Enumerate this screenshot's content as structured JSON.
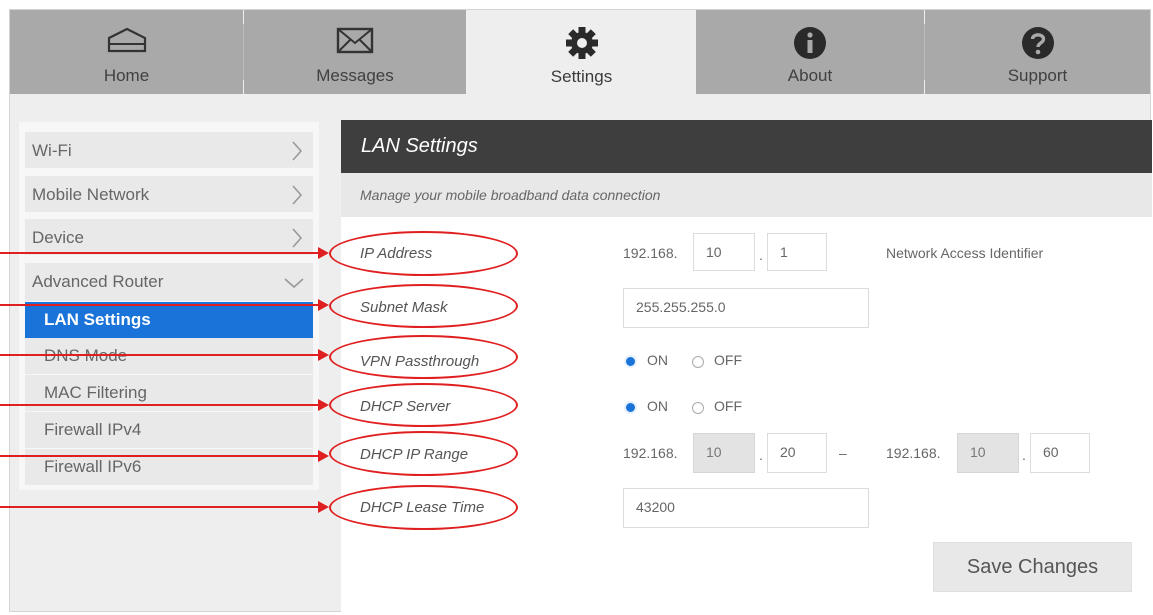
{
  "nav": {
    "tabs": [
      {
        "label": "Home",
        "icon": "home-icon"
      },
      {
        "label": "Messages",
        "icon": "envelope-icon"
      },
      {
        "label": "Settings",
        "icon": "gear-icon",
        "active": true
      },
      {
        "label": "About",
        "icon": "info-icon"
      },
      {
        "label": "Support",
        "icon": "question-icon"
      }
    ]
  },
  "sidebar": {
    "items": [
      {
        "label": "Wi-Fi"
      },
      {
        "label": "Mobile Network"
      },
      {
        "label": "Device"
      },
      {
        "label": "Advanced Router"
      }
    ],
    "sub_items": [
      {
        "label": "LAN Settings",
        "active": true
      },
      {
        "label": "DNS Mode"
      },
      {
        "label": "MAC Filtering"
      },
      {
        "label": "Firewall IPv4"
      },
      {
        "label": "Firewall IPv6"
      }
    ]
  },
  "panel": {
    "title": "LAN Settings",
    "description": "Manage your mobile broadband data connection"
  },
  "fields": {
    "ip_address": {
      "label": "IP Address",
      "prefix": "192.168.",
      "octet3": "10",
      "octet4": "1",
      "note": "Network Access Identifier"
    },
    "subnet_mask": {
      "label": "Subnet Mask",
      "value": "255.255.255.0"
    },
    "vpn_passthrough": {
      "label": "VPN Passthrough",
      "on_label": "ON",
      "off_label": "OFF",
      "selected": "ON"
    },
    "dhcp_server": {
      "label": "DHCP Server",
      "on_label": "ON",
      "off_label": "OFF",
      "selected": "ON"
    },
    "dhcp_ip_range": {
      "label": "DHCP IP Range",
      "start_prefix": "192.168.",
      "start_octet3": "10",
      "start_octet4": "20",
      "separator": "–",
      "end_prefix": "192.168.",
      "end_octet3": "10",
      "end_octet4": "60"
    },
    "dhcp_lease_time": {
      "label": "DHCP Lease Time",
      "value": "43200"
    }
  },
  "actions": {
    "save_label": "Save Changes"
  },
  "colors": {
    "accent": "#1a73d9",
    "callout": "#e02020",
    "header": "#3e3e3e",
    "tab_inactive": "#a9a9a9"
  }
}
